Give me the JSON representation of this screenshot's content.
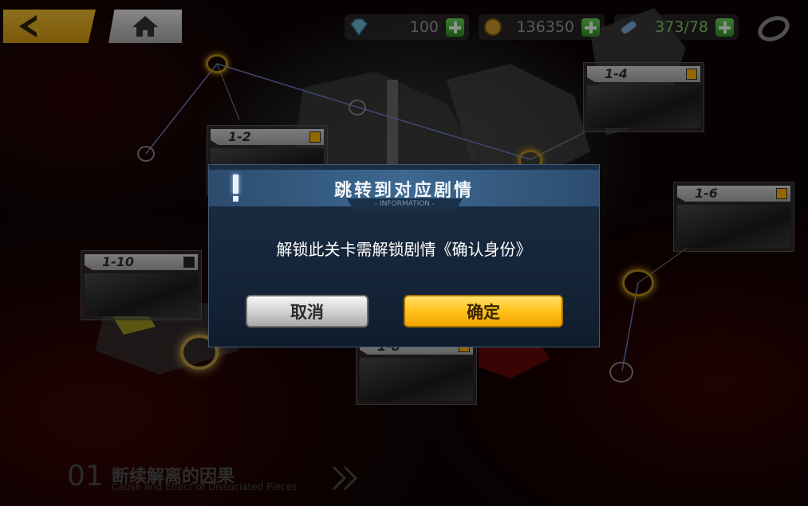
{
  "hud": {
    "gems": "100",
    "coins": "136350",
    "stamina": "373/78"
  },
  "levels": {
    "l_1_2": "1-2",
    "l_1_4": "1-4",
    "l_1_6": "1-6",
    "l_1_10": "1-10",
    "l_1_8": "1-8"
  },
  "dialog": {
    "title": "跳转到对应剧情",
    "subtitle": "- INFORMATION -",
    "message": "解锁此关卡需解锁剧情《确认身份》",
    "cancel_label": "取消",
    "confirm_label": "确定"
  },
  "chapter": {
    "number": "01",
    "title_cn": "断续解离的因果",
    "title_en": "Cause and Effect of Dissociated Pieces"
  },
  "colors": {
    "accent_yellow": "#ffc21a",
    "dialog_blue": "#1c2e44",
    "plus_green": "#3fa82f"
  },
  "icons": [
    "back-arrow-icon",
    "home-icon",
    "gem-icon",
    "coin-icon",
    "stamina-icon",
    "plus-icon",
    "ring-icon",
    "exclamation-icon",
    "double-chevron-icon"
  ]
}
